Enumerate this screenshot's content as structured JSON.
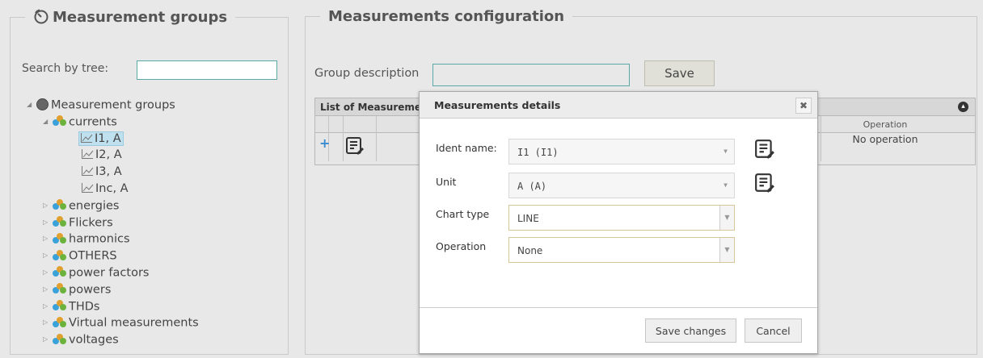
{
  "left_panel": {
    "title": "Measurement groups",
    "title_icon": "timer-icon",
    "search_label": "Search by tree:",
    "search_value": "",
    "tree": {
      "root": "Measurement groups",
      "groups": [
        {
          "label": "currents",
          "expanded": true,
          "children": [
            "I1, A",
            "I2, A",
            "I3, A",
            "Inc, A"
          ],
          "selected_child": "I1, A"
        },
        {
          "label": "energies"
        },
        {
          "label": "Flickers"
        },
        {
          "label": "harmonics"
        },
        {
          "label": "OTHERS"
        },
        {
          "label": "power factors"
        },
        {
          "label": "powers"
        },
        {
          "label": "THDs"
        },
        {
          "label": "Virtual measurements"
        },
        {
          "label": "voltages"
        }
      ]
    }
  },
  "right_panel": {
    "title": "Measurements configuration",
    "group_description_label": "Group description",
    "group_description_value": "",
    "save_label": "Save",
    "grid": {
      "caption": "List of Measurements in this group",
      "caption_visible": "List of Measuremer",
      "columns": [
        "Operation"
      ],
      "rows": [
        {
          "operation": "No operation"
        }
      ],
      "add_icon": "+"
    }
  },
  "modal": {
    "title": "Measurements details",
    "close_icon": "close-icon",
    "fields": [
      {
        "label": "Ident name:",
        "value": "I1 (I1)"
      },
      {
        "label": "Unit",
        "value": "A (A)"
      },
      {
        "label": "Chart type",
        "value": "LINE"
      },
      {
        "label": "Operation",
        "value": "None"
      }
    ],
    "save_changes_label": "Save changes",
    "cancel_label": "Cancel"
  },
  "colors": {
    "background": "#e8e8e8",
    "input_border": "#5aa9a6",
    "selection": "#bfe0ee",
    "accent_blue": "#3b8bd0"
  }
}
